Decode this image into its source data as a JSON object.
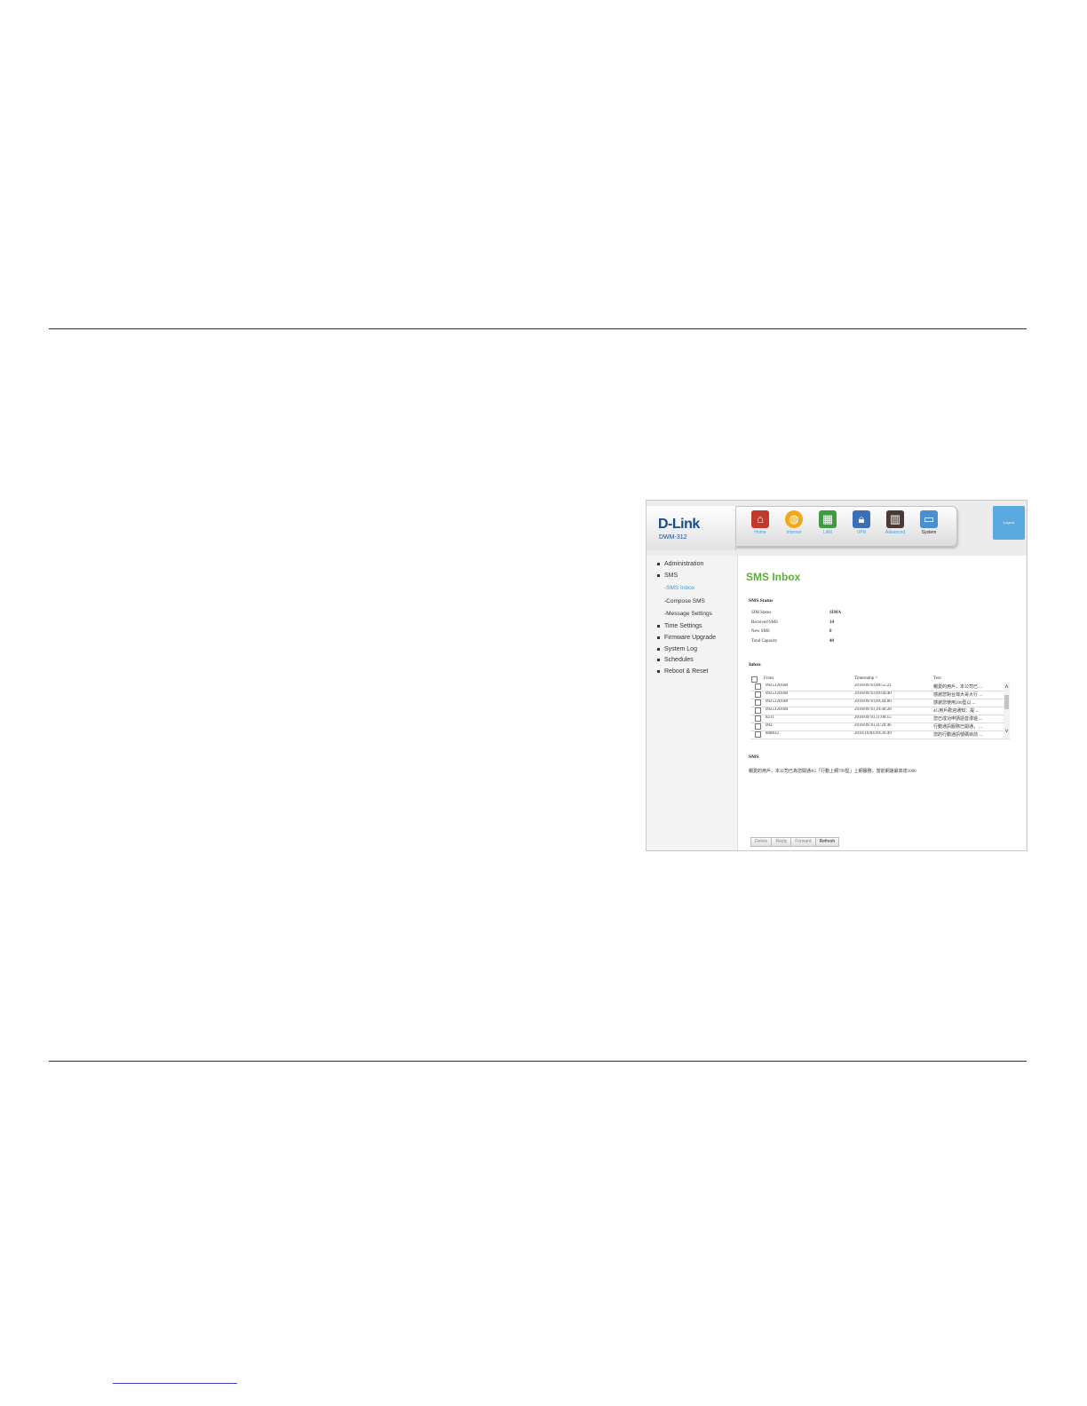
{
  "header": {
    "logo": "D-Link",
    "model": "DWM-312",
    "logout_label": "Logout"
  },
  "nav": [
    {
      "label": "Home",
      "icon": "home-icon"
    },
    {
      "label": "Internet",
      "icon": "globe-icon"
    },
    {
      "label": "LAN",
      "icon": "lan-icon"
    },
    {
      "label": "VPN",
      "icon": "lock-icon"
    },
    {
      "label": "Advanced",
      "icon": "advanced-icon"
    },
    {
      "label": "System",
      "icon": "computer-icon"
    }
  ],
  "sidebar": {
    "items": [
      "Administration",
      "SMS",
      "Time Settings",
      "Firmware Upgrade",
      "System Log",
      "Schedules",
      "Reboot & Reset"
    ],
    "sms_sub": [
      "-SMS Inbox",
      "-Compose SMS",
      "-Message Settings"
    ]
  },
  "page": {
    "title": "SMS Inbox"
  },
  "sms_status": {
    "heading": "SMS Status",
    "rows": [
      {
        "label": "SIM Status",
        "value": "SIMA"
      },
      {
        "label": "Received SMS",
        "value": "14"
      },
      {
        "label": "New SMS",
        "value": "0"
      },
      {
        "label": "Total Capacity",
        "value": "40"
      }
    ]
  },
  "inbox": {
    "heading": "Inbox",
    "columns": [
      "From",
      "Timestamp",
      "Text"
    ],
    "sort_indicator": "^",
    "rows": [
      {
        "from": "0925120188",
        "timestamp": "2016/09/10,08:55:21",
        "text": "親愛的用戶，本公司已 ..."
      },
      {
        "from": "0925120188",
        "timestamp": "2016/09/10,09:04:40",
        "text": "感謝您對台灣大哥大行 ..."
      },
      {
        "from": "0925120188",
        "timestamp": "2016/09/10,09:44:00",
        "text": "感謝您使用200型以 ..."
      },
      {
        "from": "0925120188",
        "timestamp": "2016/09/10,10:40:28",
        "text": "4G用戶歡迎通知：提 ..."
      },
      {
        "from": "8211",
        "timestamp": "2016/09/10,11:00:15",
        "text": "您已成功申請語音漫遊 ..."
      },
      {
        "from": "002",
        "timestamp": "2016/09/10,11:20:46",
        "text": "行動通訊服務已開通， ..."
      },
      {
        "from": "808832",
        "timestamp": "2016/10/04,09:26:49",
        "text": "您的行動通訊號碼目前 ..."
      }
    ]
  },
  "sms": {
    "heading": "SMS",
    "text": "親愛的用戶，本公司已為您開通4G「行動上網799型」上網服務，當前網速最高達1000"
  },
  "buttons": {
    "delete": "Delete",
    "reply": "Reply",
    "forward": "Forward",
    "refresh": "Refresh"
  }
}
